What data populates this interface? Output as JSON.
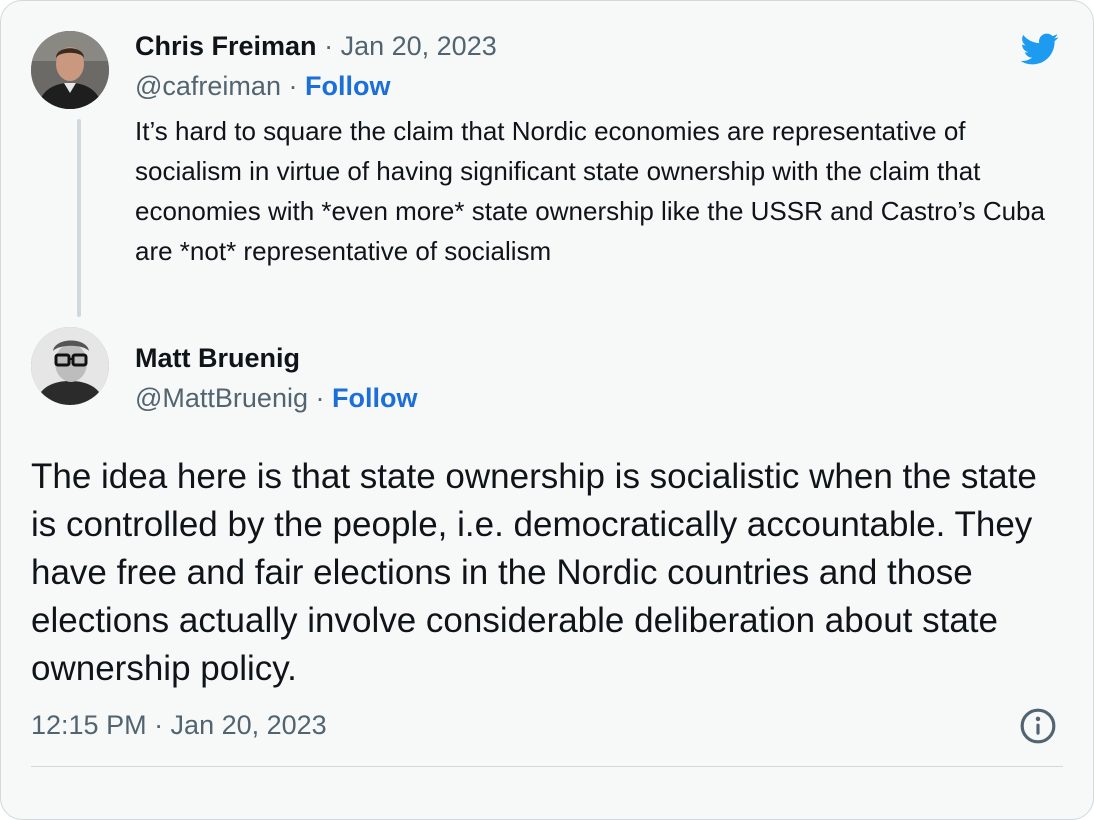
{
  "quoted_tweet": {
    "author_name": "Chris Freiman",
    "separator": "·",
    "date": "Jan 20, 2023",
    "handle": "@cafreiman",
    "follow_label": "Follow",
    "text": "It’s hard to square the claim that Nordic economies are representative of socialism in virtue of having significant state ownership with the claim that economies with *even more* state ownership like the USSR and Castro’s Cuba are *not* representative of socialism"
  },
  "reply_tweet": {
    "author_name": "Matt Bruenig",
    "handle": "@MattBruenig",
    "separator": "·",
    "follow_label": "Follow",
    "text": "The idea here is that state ownership is socialistic when the state is controlled by the people, i.e. democratically accountable. They have free and fair elections in the Nordic countries and those elections actually involve considerable deliberation about state ownership policy.",
    "timestamp": "12:15 PM · Jan 20, 2023"
  },
  "icons": {
    "brand": "twitter-bird-icon",
    "info": "info-icon"
  },
  "colors": {
    "accent": "#1d9bf0",
    "follow_link": "#1d6fd8",
    "muted_text": "#536471",
    "card_bg": "#f7f9f9"
  }
}
